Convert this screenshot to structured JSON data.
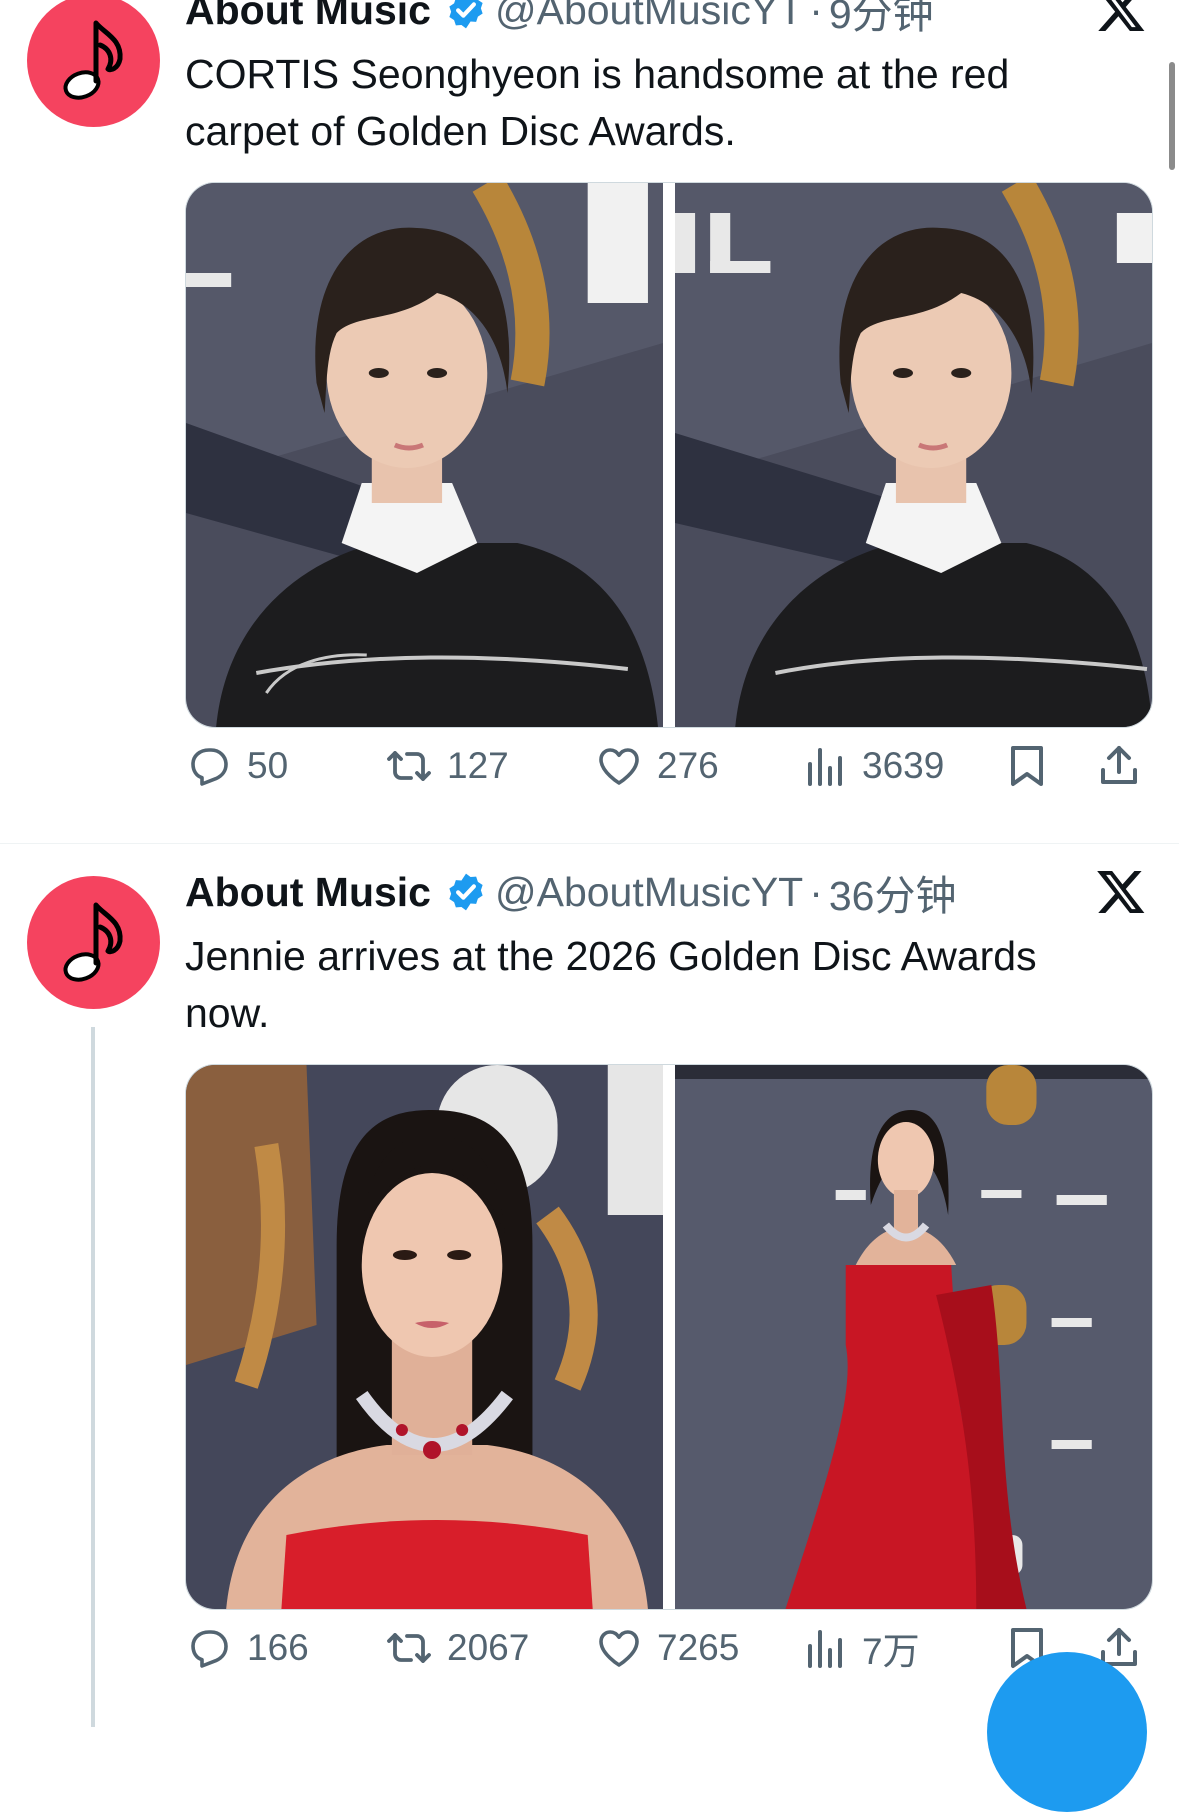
{
  "tweets": [
    {
      "author_name": "About Music",
      "handle": "@AboutMusicYT",
      "separator": "·",
      "time": "9分钟",
      "text": "CORTIS Seonghyeon is handsome at the red carpet of Golden Disc Awards.",
      "photos": [
        "photo-seonghyeon-closeup-1",
        "photo-seonghyeon-closeup-2"
      ],
      "stats": {
        "replies": "50",
        "reposts": "127",
        "likes": "276",
        "views": "3639"
      }
    },
    {
      "author_name": "About Music",
      "handle": "@AboutMusicYT",
      "separator": "·",
      "time": "36分钟",
      "text": "Jennie arrives at the 2026 Golden Disc Awards now.",
      "photos": [
        "photo-jennie-portrait",
        "photo-jennie-full-body"
      ],
      "stats": {
        "replies": "166",
        "reposts": "2067",
        "likes": "7265",
        "views": "7万"
      }
    }
  ],
  "icons": {
    "avatar": "music-note-icon",
    "verified": "verified-badge-icon",
    "platform": "x-logo-icon",
    "reply": "reply-icon",
    "repost": "repost-icon",
    "like": "heart-icon",
    "views": "views-icon",
    "bookmark": "bookmark-icon",
    "share": "share-icon"
  },
  "colors": {
    "avatar_bg": "#f5435f",
    "verified": "#1d9bf0",
    "secondary_text": "#536471",
    "fab": "#1d9bf0"
  }
}
